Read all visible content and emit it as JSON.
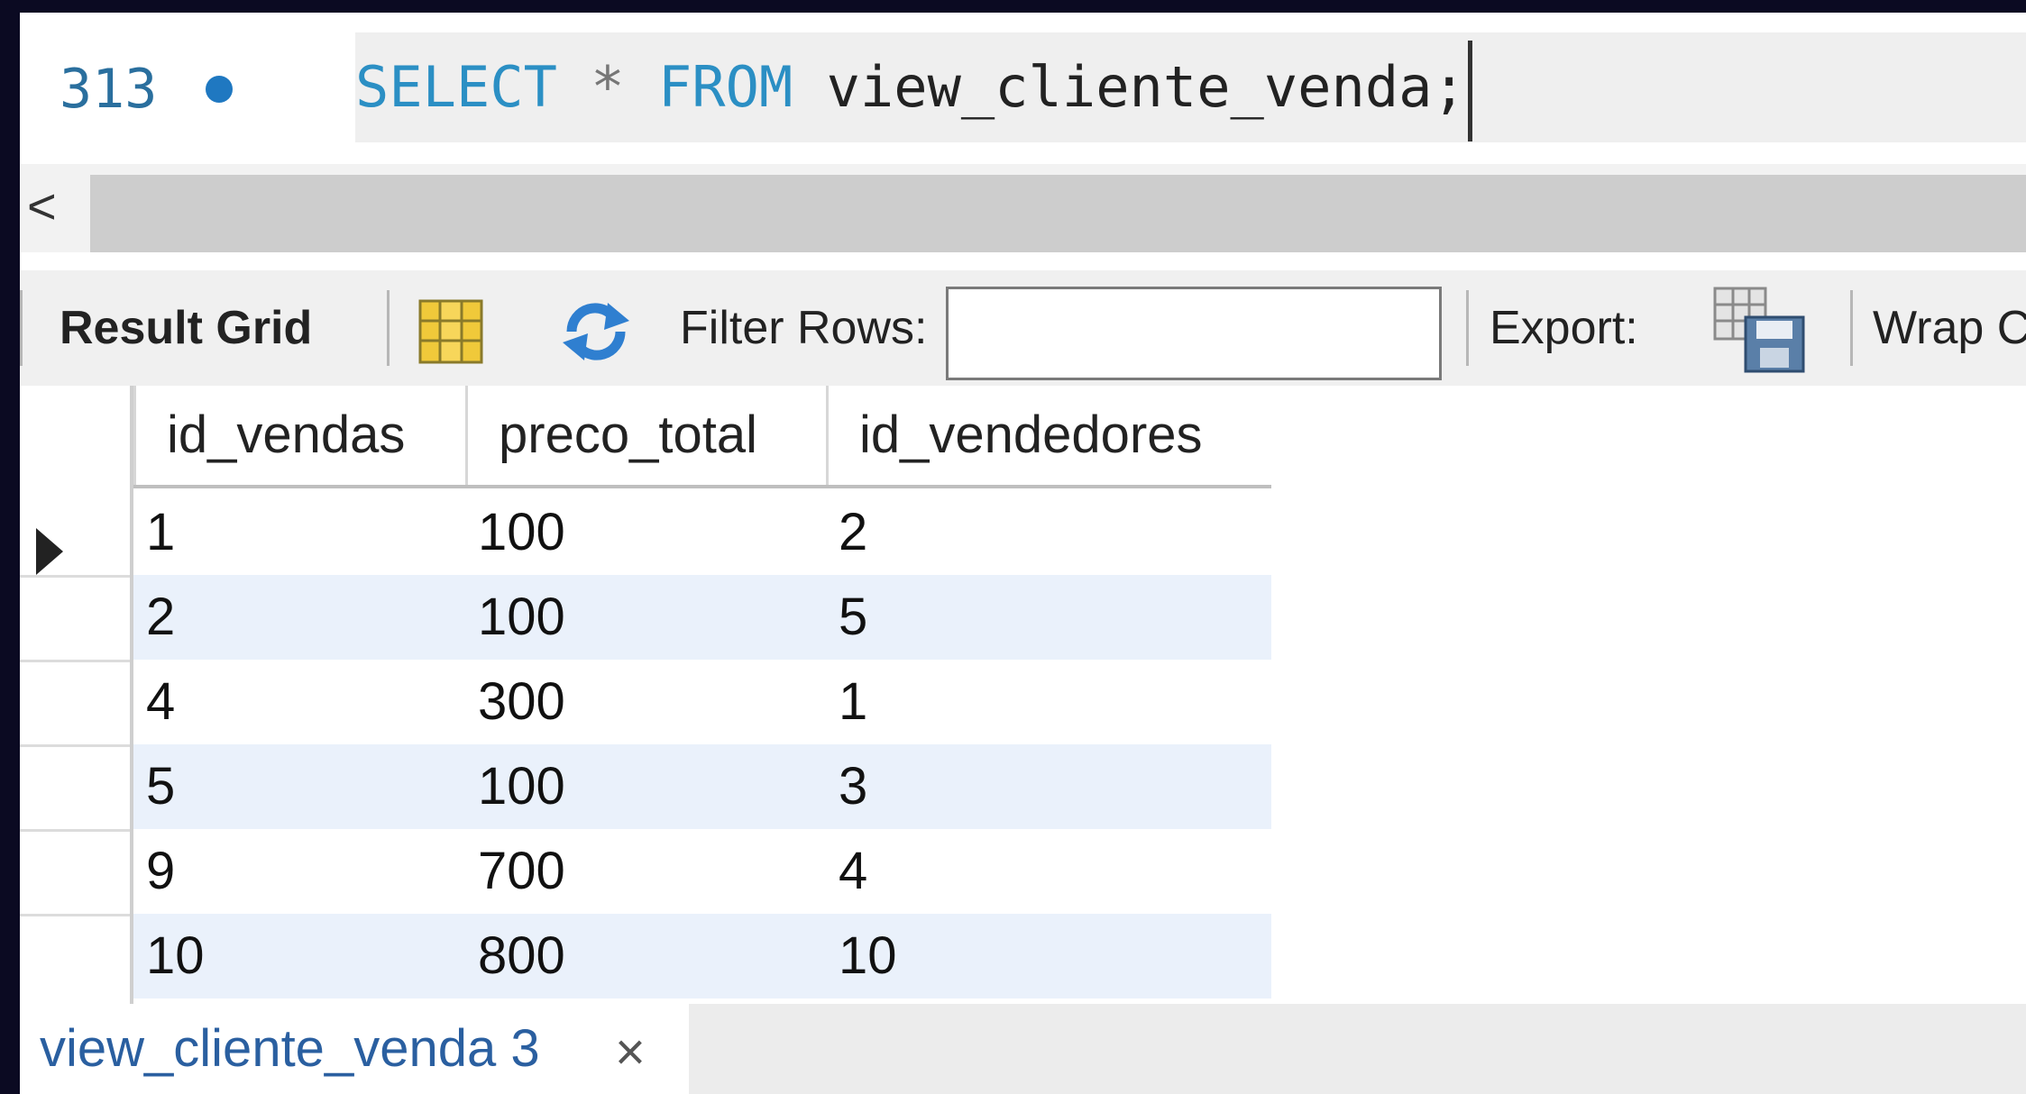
{
  "editor": {
    "line_number": "313",
    "kw_select": "SELECT",
    "star": "*",
    "kw_from": "FROM",
    "rest": "view_cliente_venda;"
  },
  "scrollbar": {
    "left_arrow": "<"
  },
  "toolbar": {
    "result_grid": "Result Grid",
    "filter_label": "Filter Rows:",
    "filter_value": "",
    "export_label": "Export:",
    "wrap_label": "Wrap C"
  },
  "grid": {
    "columns": [
      "id_vendas",
      "preco_total",
      "id_vendedores"
    ],
    "rows": [
      [
        "1",
        "100",
        "2"
      ],
      [
        "2",
        "100",
        "5"
      ],
      [
        "4",
        "300",
        "1"
      ],
      [
        "5",
        "100",
        "3"
      ],
      [
        "9",
        "700",
        "4"
      ],
      [
        "10",
        "800",
        "10"
      ]
    ]
  },
  "tabs": [
    {
      "label": "view_cliente_venda 3",
      "close": "×"
    }
  ],
  "colors": {
    "keyword": "#2b8fc4",
    "tab_label": "#2a5fa0",
    "alt_row": "#eaf1fb"
  },
  "icons": [
    "grid-layout-icon",
    "refresh-icon",
    "export-icon"
  ]
}
